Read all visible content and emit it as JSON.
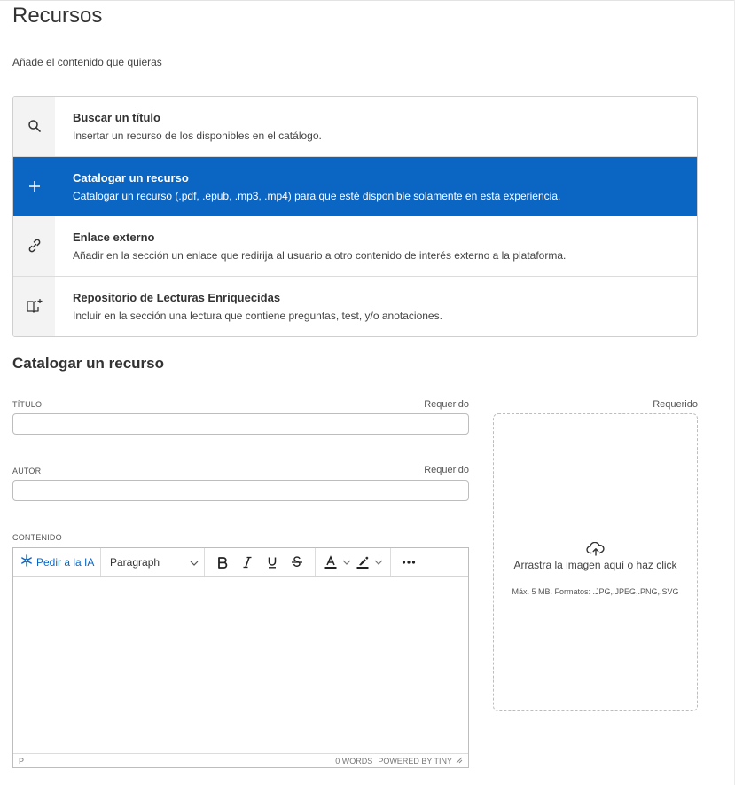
{
  "page": {
    "title": "Recursos",
    "subtitle": "Añade el contenido que quieras"
  },
  "options": [
    {
      "icon": "search-icon",
      "title": "Buscar un título",
      "description": "Insertar un recurso de los disponibles en el catálogo.",
      "active": false
    },
    {
      "icon": "plus-icon",
      "title": "Catalogar un recurso",
      "description": "Catalogar un recurso (.pdf, .epub, .mp3, .mp4) para que esté disponible solamente en esta experiencia.",
      "active": true
    },
    {
      "icon": "link-icon",
      "title": "Enlace externo",
      "description": "Añadir en la sección un enlace que redirija al usuario a otro contenido de interés externo a la plataforma.",
      "active": false
    },
    {
      "icon": "book-sparkle-icon",
      "title": "Repositorio de Lecturas Enriquecidas",
      "description": "Incluir en la sección una lectura que contiene preguntas, test, y/o anotaciones.",
      "active": false
    }
  ],
  "form": {
    "section_title": "Catalogar un recurso",
    "title_label": "TÍTULO",
    "title_required": "Requerido",
    "title_value": "",
    "author_label": "AUTOR",
    "author_required": "Requerido",
    "author_value": "",
    "content_label": "CONTENIDO",
    "image_required": "Requerido"
  },
  "editor": {
    "ai_button": "Pedir a la IA",
    "block_format": "Paragraph",
    "status_path": "P",
    "word_count": "0 WORDS",
    "powered_by": "POWERED BY TINY"
  },
  "dropzone": {
    "text": "Arrastra la imagen aquí o haz click",
    "hint": "Máx. 5 MB. Formatos: .JPG,.JPEG,.PNG,.SVG"
  },
  "colors": {
    "accent": "#0b66c3"
  }
}
